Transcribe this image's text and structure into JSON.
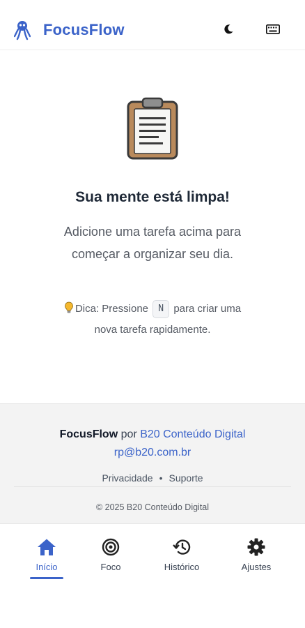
{
  "header": {
    "brand": "FocusFlow",
    "logo_icon": "octopus-icon",
    "theme_icon": "moon-icon",
    "keyboard_icon": "keyboard-icon"
  },
  "empty_state": {
    "icon": "clipboard-icon",
    "title": "Sua mente está limpa!",
    "description": "Adicione uma tarefa acima para começar a organizar seu dia.",
    "tip_prefix": "Dica: Pressione",
    "tip_key": "N",
    "tip_suffix": "para criar uma nova tarefa rapidamente."
  },
  "footer": {
    "brand": "FocusFlow",
    "by": "por",
    "company_link": "B20 Conteúdo Digital",
    "email": "rp@b20.com.br",
    "links": [
      "Privacidade",
      "Suporte"
    ],
    "separator": "•",
    "copyright": "© 2025 B20 Conteúdo Digital"
  },
  "nav": {
    "items": [
      {
        "label": "Início",
        "icon": "home-icon",
        "active": true
      },
      {
        "label": "Foco",
        "icon": "target-icon",
        "active": false
      },
      {
        "label": "Histórico",
        "icon": "history-icon",
        "active": false
      },
      {
        "label": "Ajustes",
        "icon": "gear-icon",
        "active": false
      }
    ]
  },
  "colors": {
    "accent": "#3b63c9",
    "text": "#1f2937",
    "muted": "#555a63",
    "footer_bg": "#f3f3f3"
  }
}
